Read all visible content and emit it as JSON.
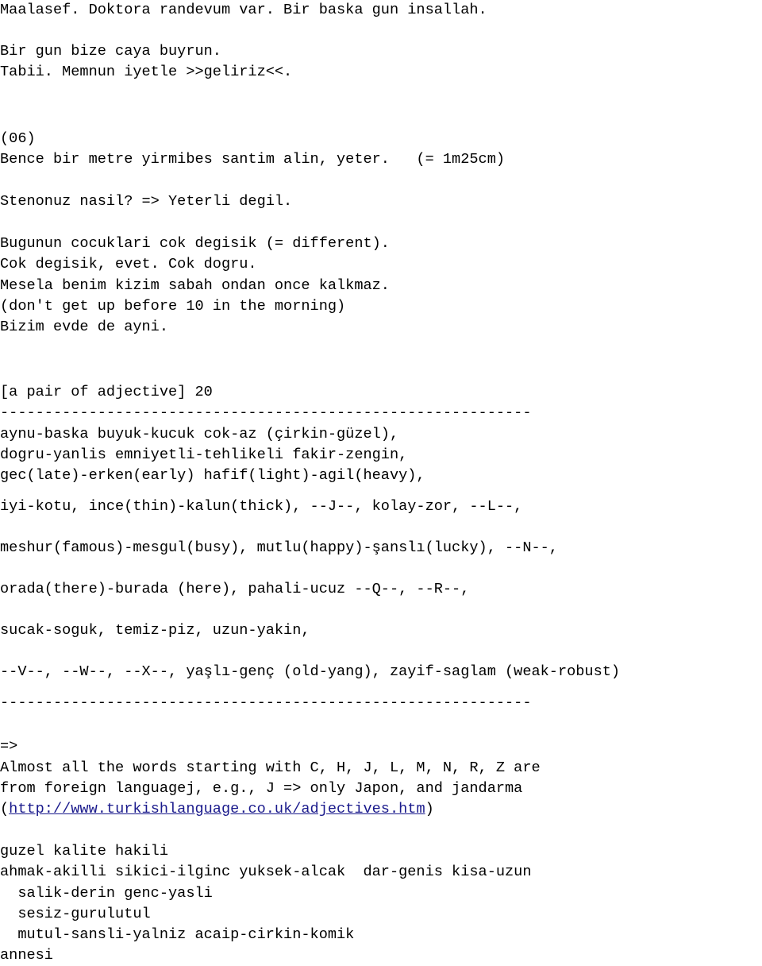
{
  "document": {
    "type": "plain-text-notes",
    "language": "Turkish / English study notes",
    "link_color": "#1a1a8c",
    "text_color": "#000000",
    "background_color": "#ffffff"
  },
  "sections": {
    "dialogue_top": {
      "lines": [
        "Maalasef. Doktora randevum var. Bir baska gun insallah.",
        "",
        "Bir gun bize caya buyrun.",
        "Tabii. Memnun iyetle >>geliriz<<."
      ]
    },
    "item_06": {
      "label": "(06)",
      "lines": [
        "(06)",
        "Bence bir metre yirmibes santim alin, yeter.   (= 1m25cm)",
        "",
        "Stenonuz nasil? => Yeterli degil."
      ]
    },
    "kids_block": {
      "lines": [
        "Bugunun cocuklari cok degisik (= different).",
        "Cok degisik, evet. Cok dogru.",
        "Mesela benim kizim sabah ondan once kalkmaz.",
        "(don't get up before 10 in the morning)",
        "Bizim evde de ayni."
      ]
    },
    "adjectives": {
      "heading": "[a pair of adjective] 20",
      "rule_top": "------------------------------------------------------------",
      "rule_bottom": "------------------------------------------------------------",
      "tight_lines": [
        "aynu-baska buyuk-kucuk cok-az (çirkin-güzel),",
        "dogru-yanlis emniyetli-tehlikeli fakir-zengin,",
        "gec(late)-erken(early) hafif(light)-agil(heavy),"
      ],
      "spaced_lines": [
        "iyi-kotu, ince(thin)-kalun(thick), --J--, kolay-zor, --L--,",
        "meshur(famous)-mesgul(busy), mutlu(happy)-şanslı(lucky), --N--,",
        "orada(there)-burada (here), pahali-ucuz --Q--, --R--,",
        "sucak-soguk, temiz-piz, uzun-yakin,",
        "--V--, --W--, --X--, yaşlı-genç (old-yang), zayif-saglam (weak-robust)"
      ]
    },
    "note_foreign": {
      "arrow": "=>",
      "lines": [
        "=>",
        "Almost all the words starting with C, H, J, L, M, N, R, Z are",
        "from foreign languagej, e.g., J => only Japon, and jandarma"
      ],
      "link_line": {
        "open_paren": "(",
        "url_text": "http://www.turkishlanguage.co.uk/adjectives.htm",
        "close_paren": ")"
      }
    },
    "word_list": {
      "lines": [
        "guzel kalite hakili",
        "ahmak-akilli sikici-ilginc yuksek-alcak  dar-genis kisa-uzun",
        "  salik-derin genc-yasli",
        "  sesiz-gurulutul",
        "  mutul-sansli-yalniz acaip-cirkin-komik",
        "annesi"
      ]
    }
  }
}
